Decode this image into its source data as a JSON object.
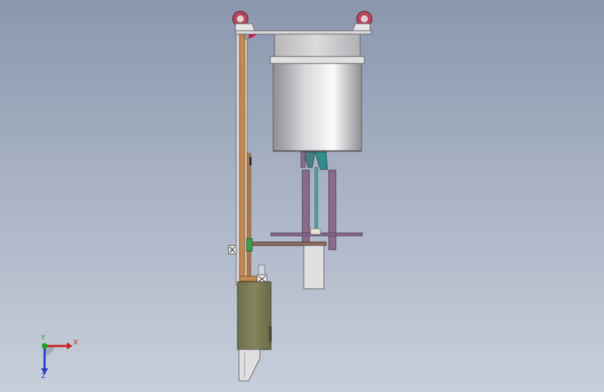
{
  "viewport": {
    "background_top": "#8b97ad",
    "background_bottom": "#c8cfdb"
  },
  "triad": {
    "x_label": "X",
    "y_label": "Y",
    "z_label": "Z",
    "x_color": "#c81e1e",
    "y_color": "#1fa12e",
    "z_color": "#2838c8"
  },
  "icons": {
    "left_wheel": "caster-wheel-icon",
    "right_wheel": "caster-wheel-icon"
  },
  "colors": {
    "frame_orange": "#c48a55",
    "bucket_silver": "#c9c9cb",
    "cabinet_olive": "#7e7e57",
    "support_purple": "#8a6b8e",
    "rod_teal": "#4fa19a",
    "bracket_red": "#c21f4a"
  }
}
